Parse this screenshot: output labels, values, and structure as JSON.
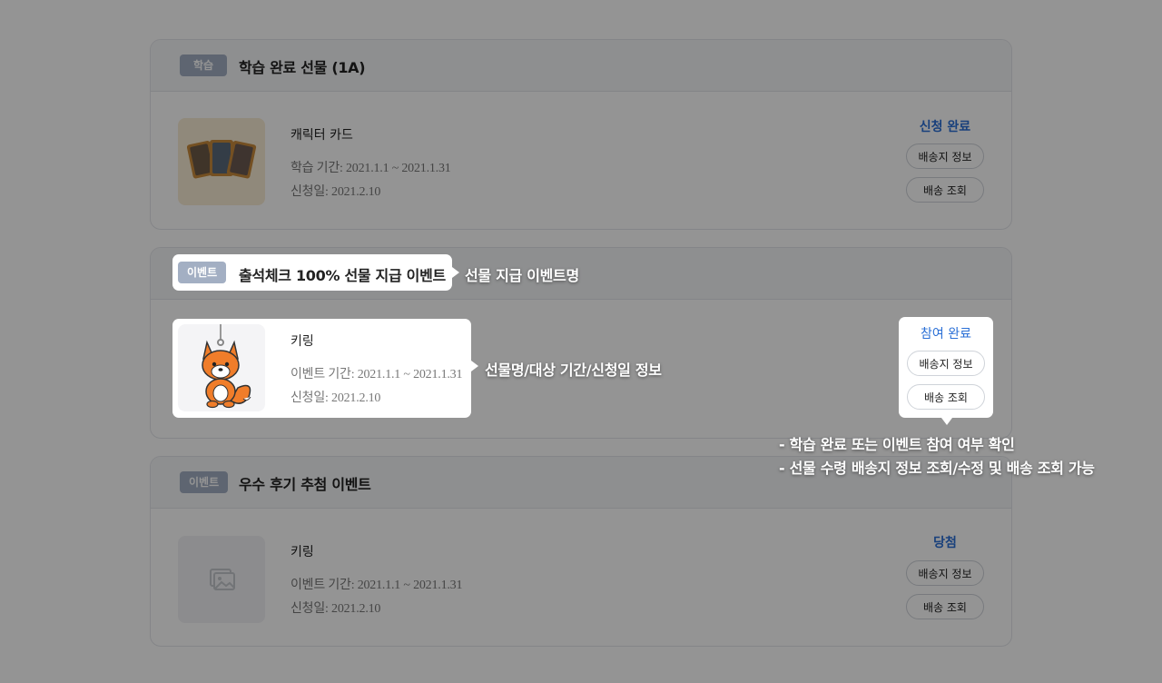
{
  "cards": [
    {
      "tag": "학습",
      "title": "학습 완료 선물 (1A)",
      "item_name": "캐릭터 카드",
      "period": "학습 기간: 2021.1.1 ~ 2021.1.31",
      "apply_date": "신청일: 2021.2.10",
      "status": "신청 완료",
      "btn_delivery_info": "배송지 정보",
      "btn_delivery_track": "배송 조회",
      "thumb_icon": "character-card-image"
    },
    {
      "tag": "이벤트",
      "title": "출석체크 100% 선물 지급 이벤트",
      "item_name": "키링",
      "period": "이벤트 기간: 2021.1.1 ~ 2021.1.31",
      "apply_date": "신청일: 2021.2.10",
      "status": "참여 완료",
      "btn_delivery_info": "배송지 정보",
      "btn_delivery_track": "배송 조회",
      "thumb_icon": "fox-keyring-image"
    },
    {
      "tag": "이벤트",
      "title": "우수 후기 추첨 이벤트",
      "item_name": "키링",
      "period": "이벤트 기간: 2021.1.1 ~ 2021.1.31",
      "apply_date": "신청일: 2021.2.10",
      "status": "당첨",
      "btn_delivery_info": "배송지 정보",
      "btn_delivery_track": "배송 조회",
      "thumb_icon": "image-placeholder-icon"
    }
  ],
  "callouts": {
    "event_name": "선물 지급 이벤트명",
    "item_info": "선물명/대상 기간/신청일 정보",
    "status_line1": "- 학습 완료 또는 이벤트 참여 여부 확인",
    "status_line2": "- 선물 수령 배송지 정보 조회/수정 및 배송 조회 가능"
  },
  "colors": {
    "accent": "#2a6fd6",
    "tag_bg": "#a3afc3",
    "overlay": "rgba(0,0,0,0.42)"
  }
}
